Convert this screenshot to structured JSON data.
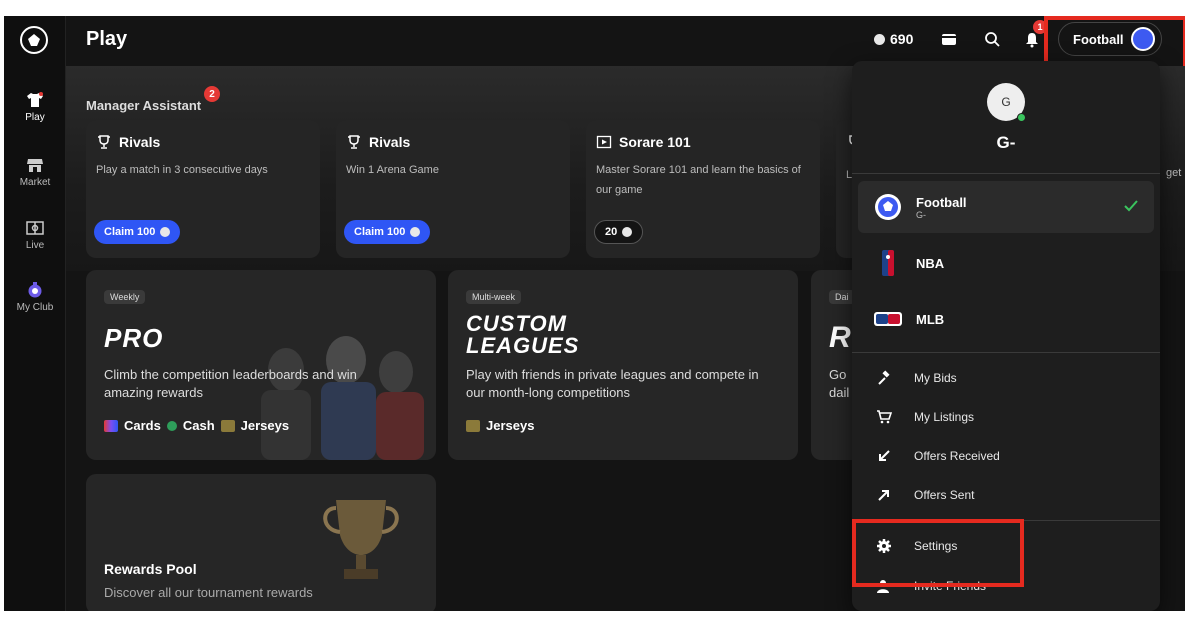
{
  "header": {
    "title": "Play",
    "coins": "690",
    "notifications": "1",
    "sport_switch": "Football"
  },
  "sidebar": {
    "items": [
      {
        "label": "Play"
      },
      {
        "label": "Market"
      },
      {
        "label": "Live"
      },
      {
        "label": "My Club"
      }
    ]
  },
  "manager_assistant": {
    "title": "Manager Assistant",
    "badge": "2",
    "tasks": [
      {
        "title": "Rivals",
        "desc": "Play a match in 3 consecutive days",
        "action": "Claim 100"
      },
      {
        "title": "Rivals",
        "desc": "Win 1 Arena Game",
        "action": "Claim 100"
      },
      {
        "title": "Sorare 101",
        "desc": "Master Sorare 101 and learn the basics of our game",
        "action": "20"
      }
    ],
    "partial_desc": "Le",
    "partial_right": "get"
  },
  "competitions": [
    {
      "tag": "Weekly",
      "logo": "PRO",
      "desc": "Climb the competition leaderboards and win amazing rewards",
      "rewards": [
        "Cards",
        "Cash",
        "Jerseys"
      ]
    },
    {
      "tag": "Multi-week",
      "logo_line1": "CUSTOM",
      "logo_line2": "LEAGUES",
      "desc": "Play with friends in private leagues and compete in our month-long competitions",
      "rewards": [
        "Jerseys"
      ]
    },
    {
      "tag": "Dai",
      "logo": "RI",
      "desc_line1": "Go",
      "desc_line2": "dail"
    }
  ],
  "rewards_pool": {
    "title": "Rewards Pool",
    "desc": "Discover all our tournament rewards"
  },
  "dropdown": {
    "avatar_initial": "G",
    "username": "G-",
    "sports": [
      {
        "name": "Football",
        "sub": "G-",
        "selected": true
      },
      {
        "name": "NBA"
      },
      {
        "name": "MLB"
      }
    ],
    "menu": [
      {
        "label": "My Bids"
      },
      {
        "label": "My Listings"
      },
      {
        "label": "Offers Received"
      },
      {
        "label": "Offers Sent"
      },
      {
        "label": "Settings"
      },
      {
        "label": "Invite Friends"
      }
    ]
  },
  "colors": {
    "accent": "#2f56f5",
    "highlight": "#e52a1f",
    "badge": "#e53935",
    "check": "#3ac45e"
  }
}
